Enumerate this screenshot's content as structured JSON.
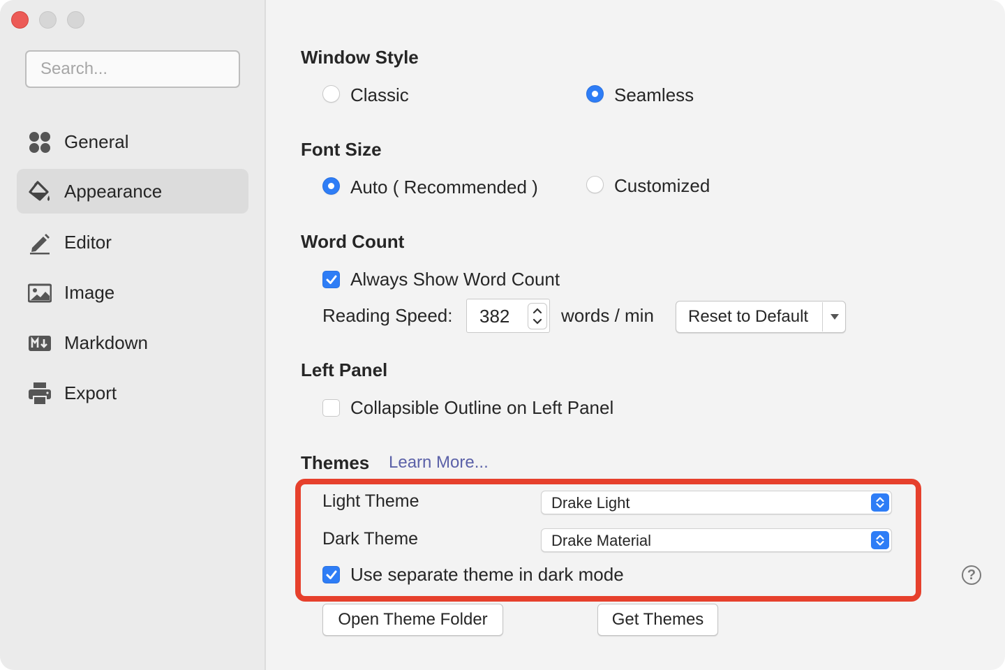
{
  "sidebar": {
    "search_placeholder": "Search...",
    "items": [
      {
        "label": "General",
        "icon": "general-icon",
        "active": false
      },
      {
        "label": "Appearance",
        "icon": "paint-bucket-icon",
        "active": true
      },
      {
        "label": "Editor",
        "icon": "pencil-icon",
        "active": false
      },
      {
        "label": "Image",
        "icon": "image-icon",
        "active": false
      },
      {
        "label": "Markdown",
        "icon": "markdown-icon",
        "active": false
      },
      {
        "label": "Export",
        "icon": "printer-icon",
        "active": false
      }
    ]
  },
  "window_style": {
    "title": "Window Style",
    "options": [
      {
        "label": "Classic",
        "selected": false
      },
      {
        "label": "Seamless",
        "selected": true
      }
    ]
  },
  "font_size": {
    "title": "Font Size",
    "options": [
      {
        "label": "Auto ( Recommended )",
        "selected": true
      },
      {
        "label": "Customized",
        "selected": false
      }
    ]
  },
  "word_count": {
    "title": "Word Count",
    "always_show_label": "Always Show Word Count",
    "always_show_checked": true,
    "reading_speed_label": "Reading Speed:",
    "reading_speed_value": "382",
    "unit_label": "words / min",
    "reset_label": "Reset to Default"
  },
  "left_panel": {
    "title": "Left Panel",
    "collapsible_label": "Collapsible Outline on Left Panel",
    "collapsible_checked": false
  },
  "themes": {
    "title": "Themes",
    "learn_more": "Learn More...",
    "light_label": "Light Theme",
    "light_value": "Drake Light",
    "dark_label": "Dark Theme",
    "dark_value": "Drake Material",
    "separate_label": "Use separate theme in dark mode",
    "separate_checked": true,
    "open_folder_label": "Open Theme Folder",
    "get_themes_label": "Get Themes"
  },
  "help": {
    "symbol": "?"
  },
  "colors": {
    "accent": "#2e7df6",
    "highlight_border": "#e6402c",
    "link": "#5b61a8"
  }
}
